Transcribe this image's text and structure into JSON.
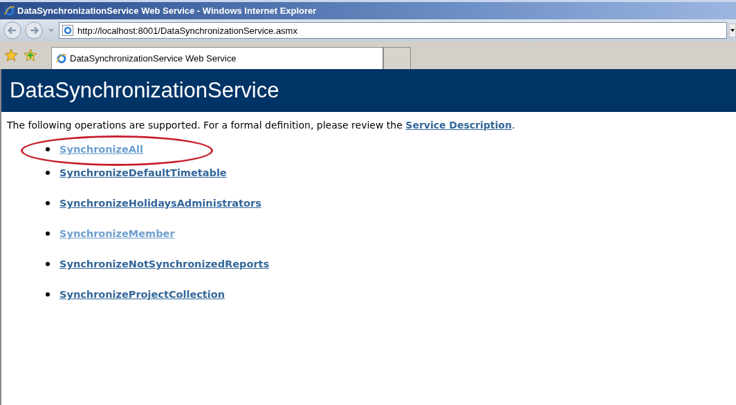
{
  "window": {
    "title": "DataSynchronizationService Web Service - Windows Internet Explorer"
  },
  "address_bar": {
    "value": "http://localhost:8001/DataSynchronizationService.asmx"
  },
  "tabs": [
    {
      "label": "DataSynchronizationService Web Service",
      "selected": true
    }
  ],
  "page": {
    "heading": "DataSynchronizationService",
    "intro": "The following operations are supported. For a formal definition, please review the ",
    "intro_link": "Service Description",
    "intro_end": ".",
    "operations": [
      {
        "label": "SynchronizeAll",
        "visited": true,
        "circled": true
      },
      {
        "label": "SynchronizeDefaultTimetable",
        "visited": false,
        "circled": false
      },
      {
        "label": "SynchronizeHolidaysAdministrators",
        "visited": false,
        "circled": false
      },
      {
        "label": "SynchronizeMember",
        "visited": true,
        "circled": false
      },
      {
        "label": "SynchronizeNotSynchronizedReports",
        "visited": false,
        "circled": false
      },
      {
        "label": "SynchronizeProjectCollection",
        "visited": false,
        "circled": false
      }
    ]
  }
}
